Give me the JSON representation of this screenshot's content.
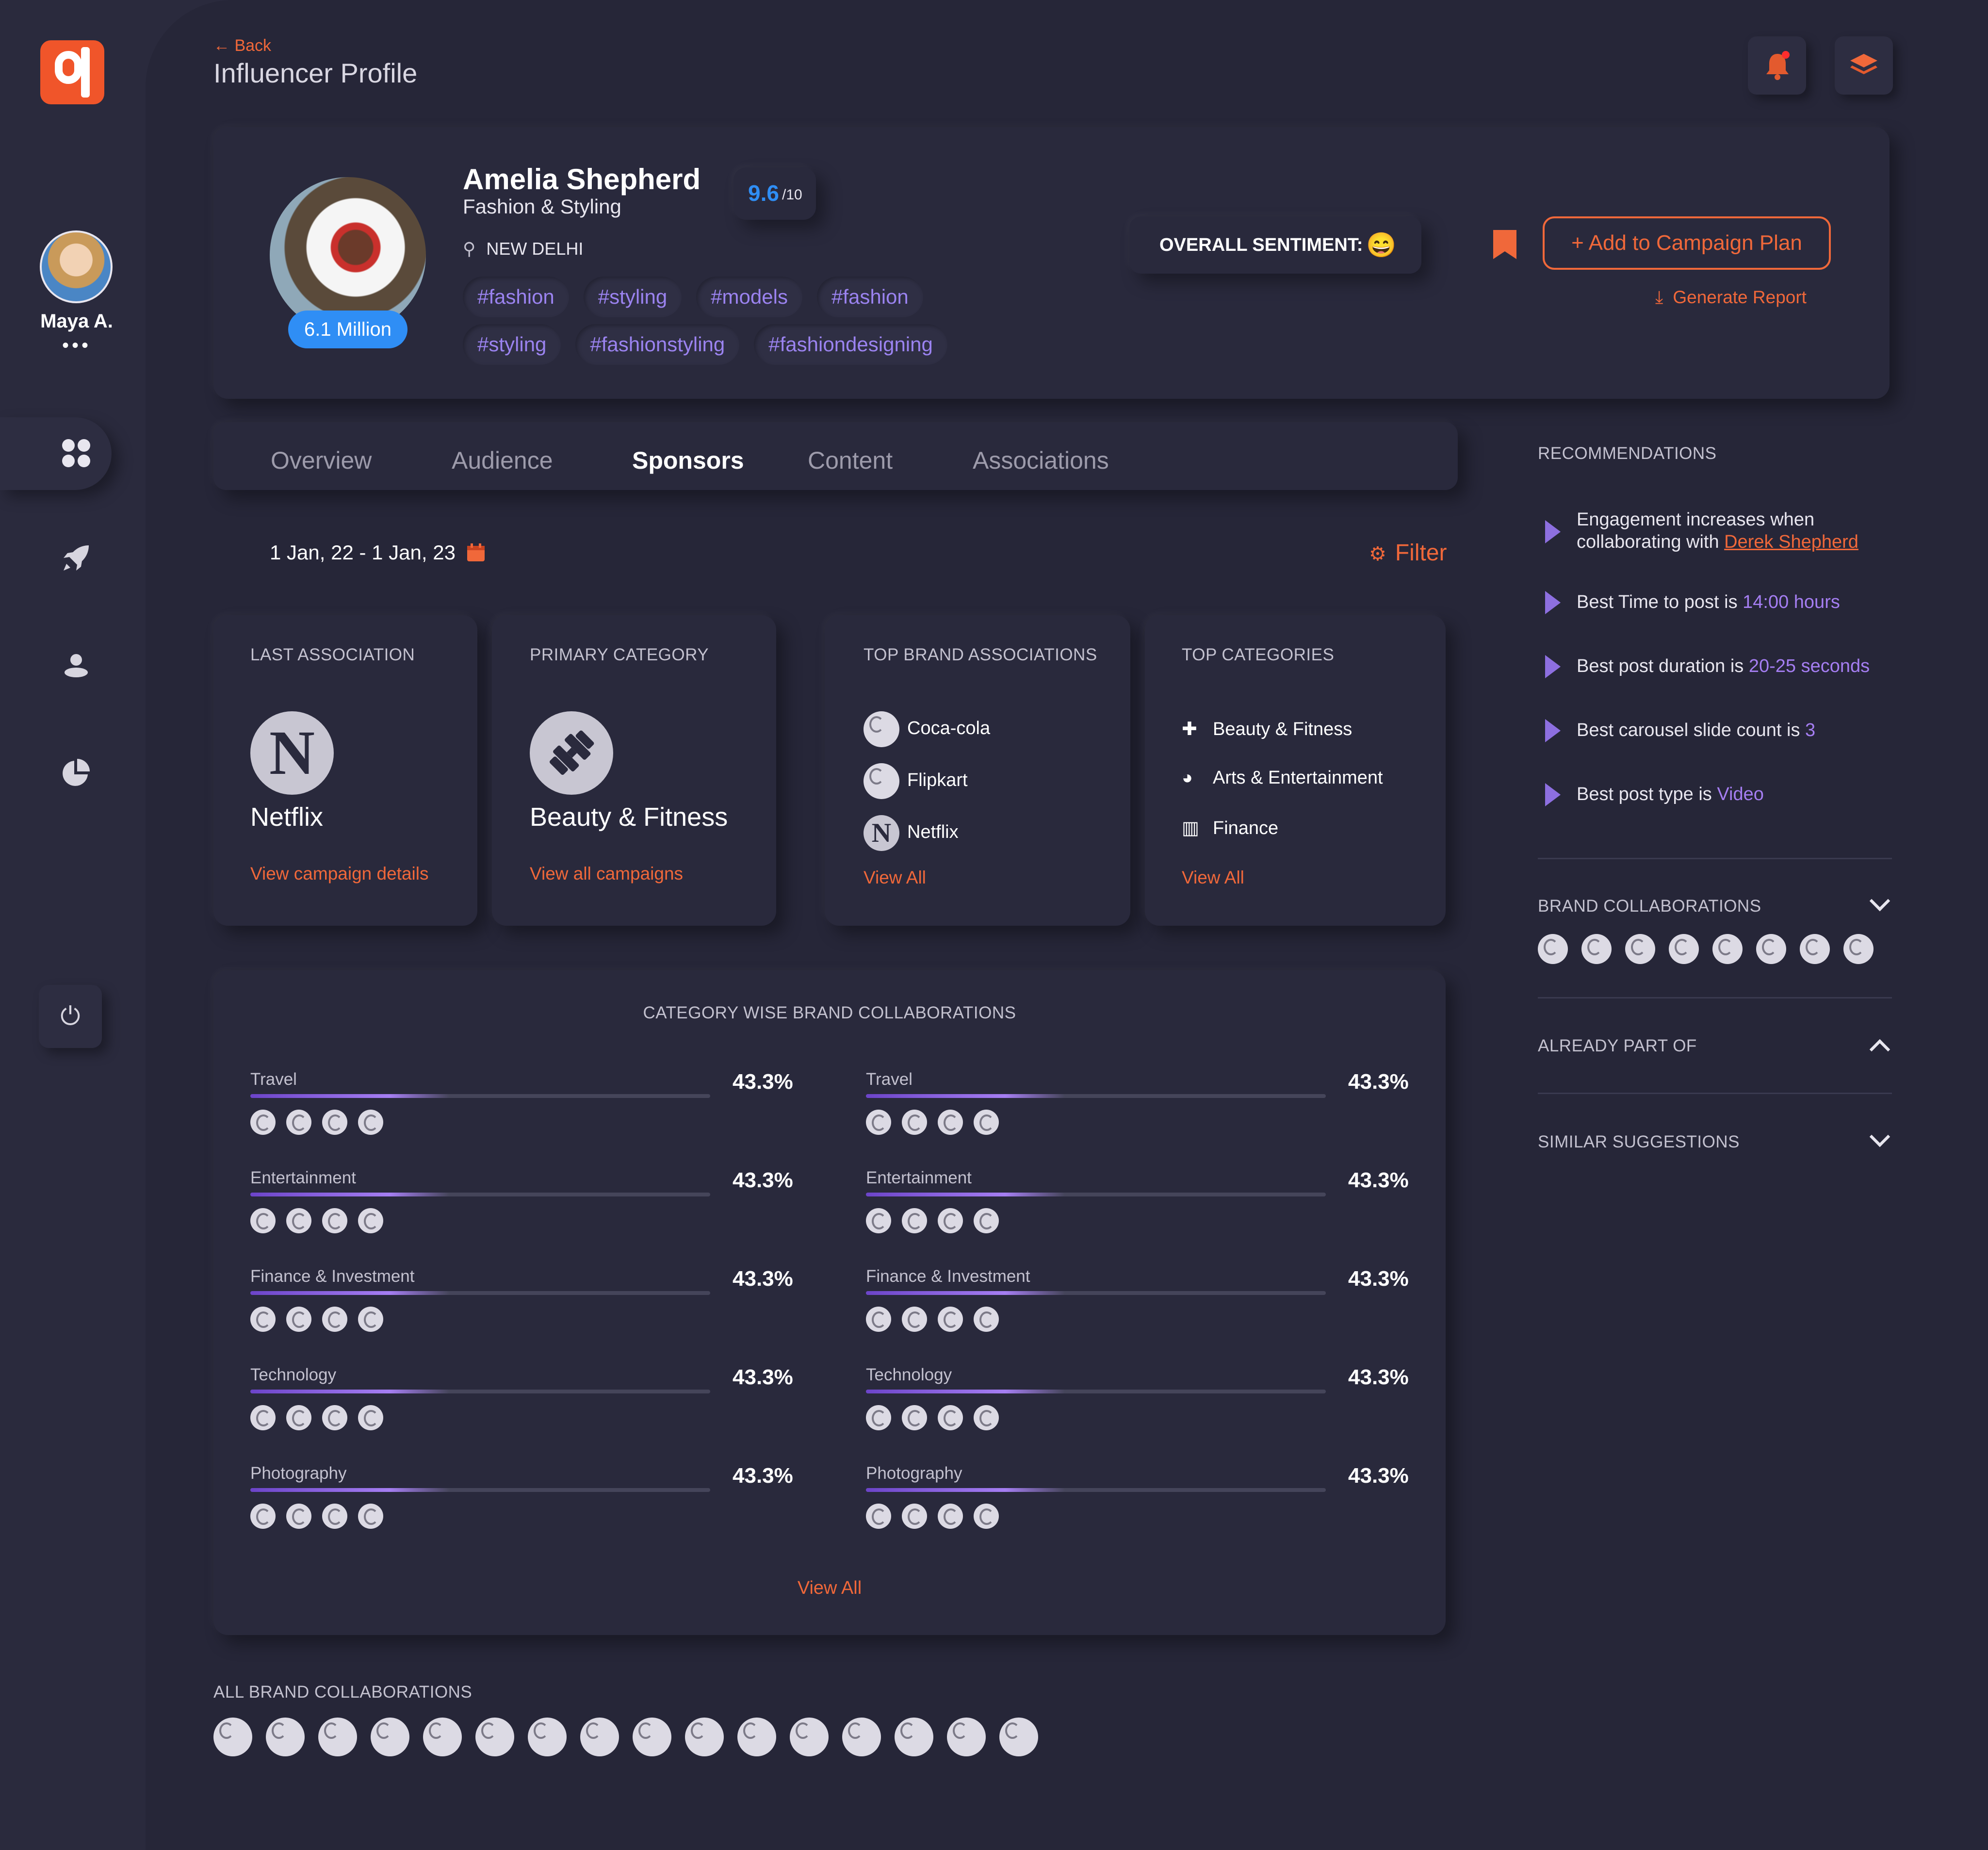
{
  "sidebar": {
    "user_name": "Maya A.",
    "user_more": "•••",
    "nav_icons": [
      "dashboard-icon",
      "rocket-icon",
      "users-icon",
      "pie-chart-icon"
    ],
    "power_icon": "power-icon"
  },
  "header": {
    "back_label": "Back",
    "title": "Influencer Profile",
    "notification_icon": "bell-icon",
    "layers_icon": "layers-icon"
  },
  "profile": {
    "name": "Amelia Shepherd",
    "category": "Fashion & Styling",
    "score": "9.6",
    "score_max": "/10",
    "location": "NEW DELHI",
    "followers": "6.1 Million",
    "tags_row1": [
      "#fashion",
      "#styling",
      "#models",
      "#fashion"
    ],
    "tags_row2": [
      "#styling",
      "#fashionstyling",
      "#fashiondesigning"
    ],
    "sentiment_label": "OVERALL SENTIMENT:",
    "sentiment_emoji": "😄",
    "add_button": "+ Add to Campaign Plan",
    "generate_report": "Generate Report"
  },
  "tabs": [
    "Overview",
    "Audience",
    "Sponsors",
    "Content",
    "Associations"
  ],
  "active_tab": "Sponsors",
  "date_range": "1 Jan, 22 - 1 Jan, 23",
  "filter_label": "Filter",
  "cards": {
    "last_association": {
      "title": "LAST ASSOCIATION",
      "value": "Netflix",
      "link": "View campaign details"
    },
    "primary_category": {
      "title": "PRIMARY CATEGORY",
      "value": "Beauty & Fitness",
      "link": "View all campaigns"
    },
    "top_brands": {
      "title": "TOP BRAND ASSOCIATIONS",
      "items": [
        "Coca-cola",
        "Flipkart",
        "Netflix"
      ],
      "link": "View All"
    },
    "top_categories": {
      "title": "TOP CATEGORIES",
      "items": [
        "Beauty & Fitness",
        "Arts & Entertainment",
        "Finance"
      ],
      "link": "View All"
    }
  },
  "category_section": {
    "title": "CATEGORY WISE BRAND COLLABORATIONS",
    "view_all": "View All",
    "left": [
      {
        "label": "Travel",
        "value": "43.3%",
        "fraction": 0.433
      },
      {
        "label": "Entertainment",
        "value": "43.3%",
        "fraction": 0.433
      },
      {
        "label": "Finance & Investment",
        "value": "43.3%",
        "fraction": 0.433
      },
      {
        "label": "Technology",
        "value": "43.3%",
        "fraction": 0.433
      },
      {
        "label": "Photography",
        "value": "43.3%",
        "fraction": 0.433
      }
    ],
    "right": [
      {
        "label": "Travel",
        "value": "43.3%",
        "fraction": 0.433
      },
      {
        "label": "Entertainment",
        "value": "43.3%",
        "fraction": 0.433
      },
      {
        "label": "Finance & Investment",
        "value": "43.3%",
        "fraction": 0.433
      },
      {
        "label": "Technology",
        "value": "43.3%",
        "fraction": 0.433
      },
      {
        "label": "Photography",
        "value": "43.3%",
        "fraction": 0.433
      }
    ]
  },
  "all_brands_label": "ALL BRAND COLLABORATIONS",
  "recommendations": {
    "title": "RECOMMENDATIONS",
    "r1_text": "Engagement increases when",
    "r1_text2": "collaborating with",
    "r1_link": "Derek Shepherd",
    "r2_text": "Best Time to post is",
    "r2_value": "14:00 hours",
    "r3_text": "Best post duration is",
    "r3_value": "20-25 seconds",
    "r4_text": "Best carousel slide count is",
    "r4_value": "3",
    "r5_text": "Best post type is",
    "r5_value": "Video"
  },
  "side_sections": {
    "brand_collabs": "BRAND COLLABORATIONS",
    "already_part_of": "ALREADY PART OF",
    "similar": "SIMILAR SUGGESTIONS"
  },
  "colors": {
    "accent": "#f0683a",
    "purple": "#a57ef2",
    "blue": "#2f8ef5",
    "bg": "#262638"
  }
}
